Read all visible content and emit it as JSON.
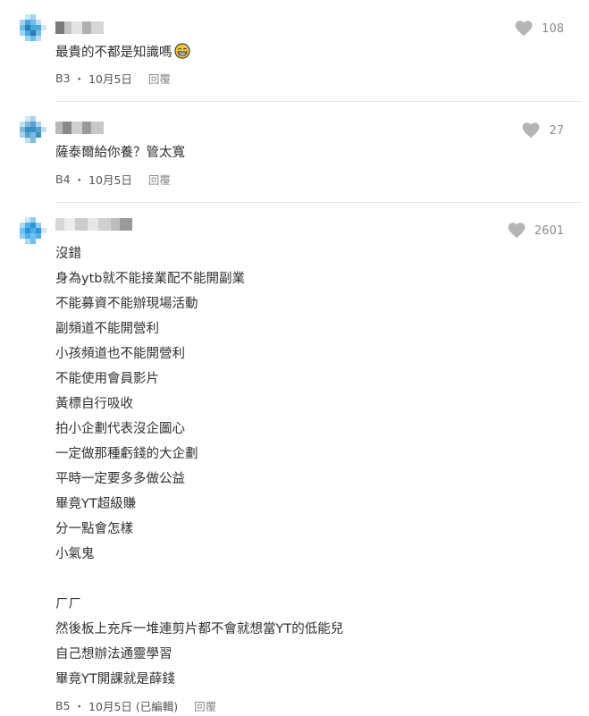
{
  "colors": {
    "heart": "#b5b5b5",
    "avatar_light": "#9fd4f2",
    "avatar_mid": "#4aa8de",
    "avatar_dark": "#2a7db3",
    "divider": "#e6e6e6"
  },
  "comments": [
    {
      "floor": "B3",
      "date": "10月5日",
      "edited": "",
      "reply_label": "回覆",
      "likes": "108",
      "lines": [
        "最貴的不都是知識嗎"
      ],
      "emoji": "grinning-sweat-emoji"
    },
    {
      "floor": "B4",
      "date": "10月5日",
      "edited": "",
      "reply_label": "回覆",
      "likes": "27",
      "lines": [
        "薩泰爾給你養？管太寬"
      ]
    },
    {
      "floor": "B5",
      "date": "10月5日",
      "edited": "(已編輯)",
      "reply_label": "回覆",
      "likes": "2601",
      "lines": [
        "沒錯",
        "身為ytb就不能接業配不能開副業",
        "不能募資不能辦現場活動",
        "副頻道不能開營利",
        "小孩頻道也不能開營利",
        "不能使用會員影片",
        "黃標自行吸收",
        "拍小企劃代表沒企圖心",
        "一定做那種虧錢的大企劃",
        "平時一定要多多做公益",
        "畢竟YT超級賺",
        "分一點會怎樣",
        "小氣鬼",
        "",
        "ㄏㄏ",
        "然後板上充斥一堆連剪片都不會就想當YT的低能兒",
        "自己想辦法通靈學習",
        "畢竟YT開課就是薛錢"
      ]
    }
  ],
  "meta_separator": "・"
}
